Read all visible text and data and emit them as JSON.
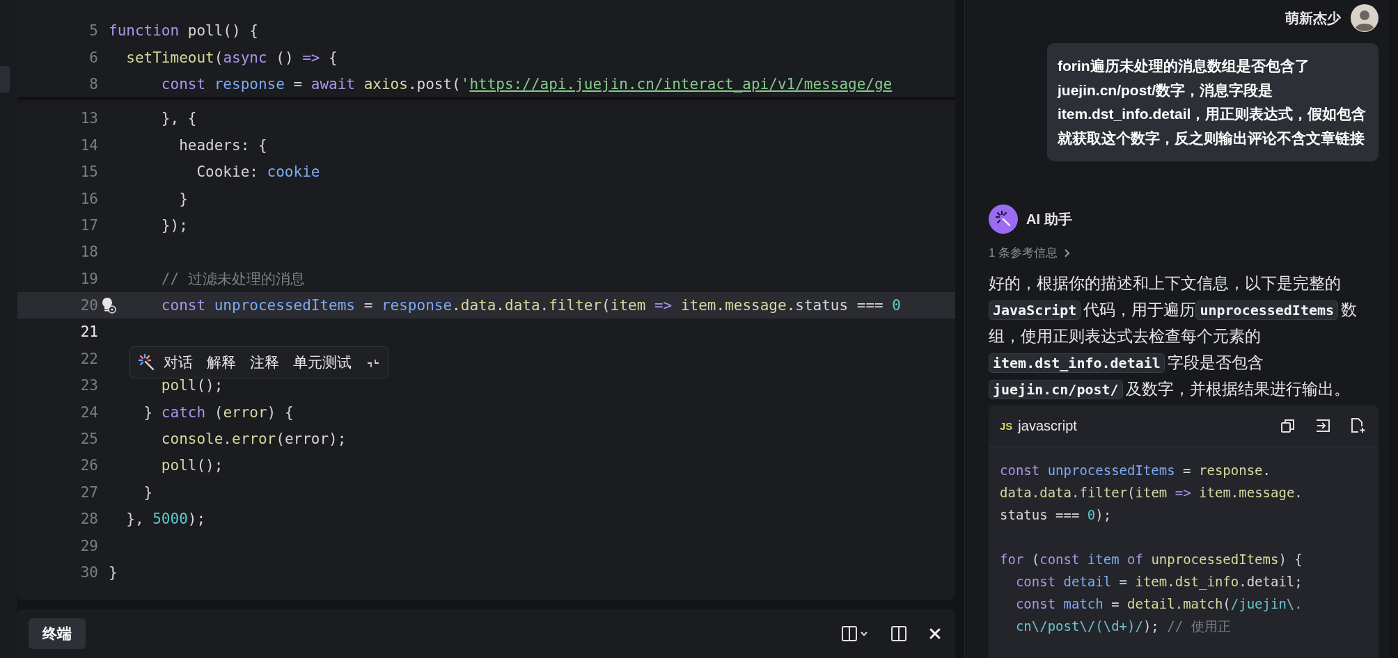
{
  "editor": {
    "pinned_lines": [
      {
        "number": "5",
        "current": false,
        "highlighted": false,
        "tokens": [
          {
            "kind": "keyword",
            "text": "function "
          },
          {
            "kind": "plain",
            "text": "poll() {"
          }
        ]
      },
      {
        "number": "6",
        "current": false,
        "highlighted": false,
        "tokens": [
          {
            "kind": "function",
            "text": "  setTimeout"
          },
          {
            "kind": "plain",
            "text": "("
          },
          {
            "kind": "keyword",
            "text": "async "
          },
          {
            "kind": "plain",
            "text": "() "
          },
          {
            "kind": "keyword",
            "text": "=>"
          },
          {
            "kind": "plain",
            "text": " {"
          }
        ]
      },
      {
        "number": "8",
        "current": false,
        "highlighted": false,
        "tokens": [
          {
            "kind": "keyword",
            "text": "      const "
          },
          {
            "kind": "variable",
            "text": "response"
          },
          {
            "kind": "plain",
            "text": " = "
          },
          {
            "kind": "keyword",
            "text": "await "
          },
          {
            "kind": "function",
            "text": "axios"
          },
          {
            "kind": "plain",
            "text": ".post("
          },
          {
            "kind": "string",
            "text": "'"
          },
          {
            "kind": "url",
            "text": "https://api.juejin.cn/interact_api/v1/message/ge"
          }
        ]
      }
    ],
    "lines": [
      {
        "number": "13",
        "current": false,
        "highlighted": false,
        "tokens": [
          {
            "kind": "plain",
            "text": "      }, {"
          }
        ]
      },
      {
        "number": "14",
        "current": false,
        "highlighted": false,
        "tokens": [
          {
            "kind": "plain",
            "text": "        headers: {"
          }
        ]
      },
      {
        "number": "15",
        "current": false,
        "highlighted": false,
        "tokens": [
          {
            "kind": "plain",
            "text": "          Cookie: "
          },
          {
            "kind": "variable",
            "text": "cookie"
          }
        ]
      },
      {
        "number": "16",
        "current": false,
        "highlighted": false,
        "tokens": [
          {
            "kind": "plain",
            "text": "        }"
          }
        ]
      },
      {
        "number": "17",
        "current": false,
        "highlighted": false,
        "tokens": [
          {
            "kind": "plain",
            "text": "      });"
          }
        ]
      },
      {
        "number": "18",
        "current": false,
        "highlighted": false
      },
      {
        "number": "19",
        "current": false,
        "highlighted": false,
        "tokens": [
          {
            "kind": "comment",
            "text": "      // 过滤未处理的消息"
          }
        ]
      },
      {
        "number": "20",
        "current": false,
        "highlighted": true,
        "tokens": [
          {
            "kind": "keyword",
            "text": "      const "
          },
          {
            "kind": "variable",
            "text": "unprocessedItems"
          },
          {
            "kind": "plain",
            "text": " = "
          },
          {
            "kind": "variable",
            "text": "response"
          },
          {
            "kind": "plain",
            "text": "."
          },
          {
            "kind": "function",
            "text": "data"
          },
          {
            "kind": "plain",
            "text": "."
          },
          {
            "kind": "function",
            "text": "data"
          },
          {
            "kind": "plain",
            "text": "."
          },
          {
            "kind": "function",
            "text": "filter"
          },
          {
            "kind": "plain",
            "text": "("
          },
          {
            "kind": "function",
            "text": "item"
          },
          {
            "kind": "keyword",
            "text": " => "
          },
          {
            "kind": "function",
            "text": "item"
          },
          {
            "kind": "plain",
            "text": "."
          },
          {
            "kind": "function",
            "text": "message"
          },
          {
            "kind": "plain",
            "text": ".status === "
          },
          {
            "kind": "number",
            "text": "0"
          }
        ]
      },
      {
        "number": "21",
        "current": true,
        "highlighted": false
      },
      {
        "number": "22",
        "current": false,
        "highlighted": false
      },
      {
        "number": "23",
        "current": false,
        "highlighted": false,
        "tokens": [
          {
            "kind": "function",
            "text": "      poll"
          },
          {
            "kind": "plain",
            "text": "();"
          }
        ]
      },
      {
        "number": "24",
        "current": false,
        "highlighted": false,
        "tokens": [
          {
            "kind": "plain",
            "text": "    } "
          },
          {
            "kind": "keyword",
            "text": "catch "
          },
          {
            "kind": "plain",
            "text": "("
          },
          {
            "kind": "function",
            "text": "error"
          },
          {
            "kind": "plain",
            "text": ") {"
          }
        ]
      },
      {
        "number": "25",
        "current": false,
        "highlighted": false,
        "tokens": [
          {
            "kind": "function",
            "text": "      console"
          },
          {
            "kind": "plain",
            "text": "."
          },
          {
            "kind": "function",
            "text": "error"
          },
          {
            "kind": "plain",
            "text": "(error);"
          }
        ]
      },
      {
        "number": "26",
        "current": false,
        "highlighted": false,
        "tokens": [
          {
            "kind": "function",
            "text": "      poll"
          },
          {
            "kind": "plain",
            "text": "();"
          }
        ]
      },
      {
        "number": "27",
        "current": false,
        "highlighted": false,
        "tokens": [
          {
            "kind": "plain",
            "text": "    }"
          }
        ]
      },
      {
        "number": "28",
        "current": false,
        "highlighted": false,
        "tokens": [
          {
            "kind": "plain",
            "text": "  }, "
          },
          {
            "kind": "number",
            "text": "5000"
          },
          {
            "kind": "plain",
            "text": ");"
          }
        ]
      },
      {
        "number": "29",
        "current": false,
        "highlighted": false
      },
      {
        "number": "30",
        "current": false,
        "highlighted": false,
        "tokens": [
          {
            "kind": "plain",
            "text": "}"
          }
        ]
      }
    ],
    "inline_toolbar": {
      "actions": [
        "对话",
        "解释",
        "注释",
        "单元测试"
      ]
    }
  },
  "terminal_panel": {
    "tabs": [
      {
        "label": "终端",
        "selected": true
      }
    ]
  },
  "chat": {
    "user": {
      "name": "萌新杰少"
    },
    "user_message": "forin遍历未处理的消息数组是否包含了juejin.cn/post/数字，消息字段是item.dst_info.detail，用正则表达式，假如包含就获取这个数字，反之则输出评论不含文章链接",
    "assistant": {
      "name": "AI 助手",
      "references": "1 条参考信息",
      "answer": [
        {
          "kind": "text",
          "text": "好的，根据你的描述和上下文信息，以下是完整的"
        },
        {
          "kind": "code",
          "text": "JavaScript"
        },
        {
          "kind": "text",
          "text": "代码，用于遍历"
        },
        {
          "kind": "code",
          "text": "unprocessedItems"
        },
        {
          "kind": "text",
          "text": "数组，使用正则表达式去检查每个元素的"
        },
        {
          "kind": "code",
          "text": "item.dst_info.detail"
        },
        {
          "kind": "text",
          "text": "字段是否包含"
        },
        {
          "kind": "code",
          "text": "juejin.cn/post/"
        },
        {
          "kind": "text",
          "text": "及数字，并根据结果进行输出。"
        }
      ],
      "code_block": {
        "badge": "JS",
        "language": "javascript",
        "lines": [
          {
            "kind": "code",
            "tokens": [
              {
                "kind": "keyword",
                "text": "const "
              },
              {
                "kind": "variable",
                "text": "unprocessedItems"
              },
              {
                "kind": "plain",
                "text": " = "
              },
              {
                "kind": "function",
                "text": "response"
              },
              {
                "kind": "plain",
                "text": "."
              }
            ]
          },
          {
            "kind": "code",
            "tokens": [
              {
                "kind": "function",
                "text": "data"
              },
              {
                "kind": "plain",
                "text": "."
              },
              {
                "kind": "function",
                "text": "data"
              },
              {
                "kind": "plain",
                "text": "."
              },
              {
                "kind": "function",
                "text": "filter"
              },
              {
                "kind": "plain",
                "text": "("
              },
              {
                "kind": "function",
                "text": "item"
              },
              {
                "kind": "keyword",
                "text": " => "
              },
              {
                "kind": "function",
                "text": "item"
              },
              {
                "kind": "plain",
                "text": "."
              },
              {
                "kind": "function",
                "text": "message"
              },
              {
                "kind": "plain",
                "text": "."
              }
            ]
          },
          {
            "kind": "code",
            "tokens": [
              {
                "kind": "plain",
                "text": "status === "
              },
              {
                "kind": "number",
                "text": "0"
              },
              {
                "kind": "plain",
                "text": ");"
              }
            ]
          },
          {
            "kind": "blank"
          },
          {
            "kind": "code",
            "tokens": [
              {
                "kind": "keyword",
                "text": "for "
              },
              {
                "kind": "plain",
                "text": "("
              },
              {
                "kind": "keyword",
                "text": "const "
              },
              {
                "kind": "variable",
                "text": "item "
              },
              {
                "kind": "keyword",
                "text": "of "
              },
              {
                "kind": "function",
                "text": "unprocessedItems"
              },
              {
                "kind": "plain",
                "text": ") {"
              }
            ]
          },
          {
            "kind": "code",
            "tokens": [
              {
                "kind": "keyword",
                "text": "  const "
              },
              {
                "kind": "variable",
                "text": "detail"
              },
              {
                "kind": "plain",
                "text": " = "
              },
              {
                "kind": "function",
                "text": "item"
              },
              {
                "kind": "plain",
                "text": "."
              },
              {
                "kind": "function",
                "text": "dst_info"
              },
              {
                "kind": "plain",
                "text": ".detail;"
              }
            ]
          },
          {
            "kind": "code",
            "tokens": [
              {
                "kind": "keyword",
                "text": "  const "
              },
              {
                "kind": "variable",
                "text": "match"
              },
              {
                "kind": "plain",
                "text": " = "
              },
              {
                "kind": "function",
                "text": "detail"
              },
              {
                "kind": "plain",
                "text": "."
              },
              {
                "kind": "function",
                "text": "match"
              },
              {
                "kind": "plain",
                "text": "("
              },
              {
                "kind": "regex",
                "text": "/juejin\\."
              }
            ]
          },
          {
            "kind": "code",
            "tokens": [
              {
                "kind": "regex",
                "text": "  cn\\/post\\/(\\d+)/"
              },
              {
                "kind": "plain",
                "text": "); "
              },
              {
                "kind": "comment",
                "text": "// 使用正"
              }
            ]
          }
        ]
      }
    }
  }
}
